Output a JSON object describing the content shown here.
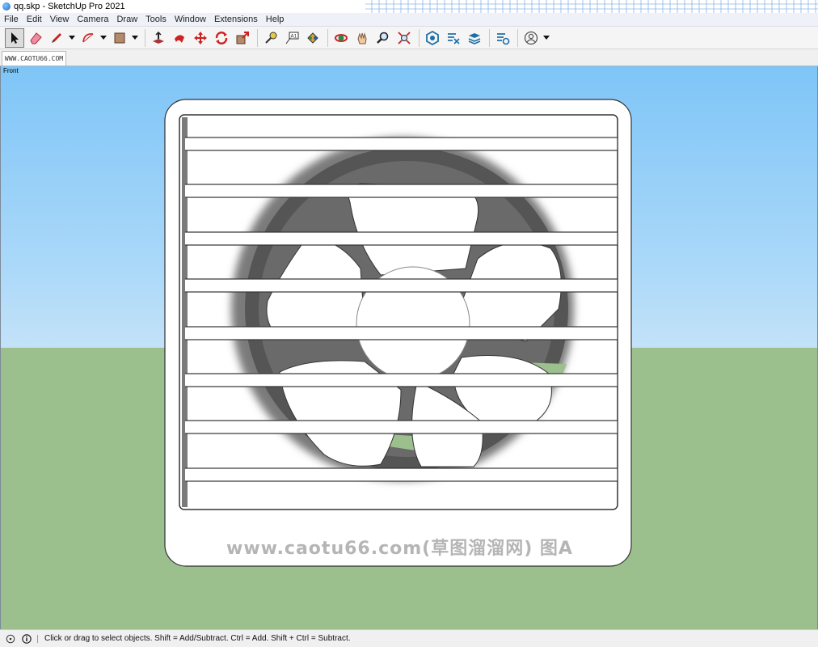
{
  "window": {
    "title": "qq.skp - SketchUp Pro 2021"
  },
  "menu": [
    "File",
    "Edit",
    "View",
    "Camera",
    "Draw",
    "Tools",
    "Window",
    "Extensions",
    "Help"
  ],
  "toolbar": {
    "tools": [
      "select-arrow-icon",
      "eraser-icon",
      "pencil-line-icon",
      "arc-icon",
      "shape-rectangle-icon",
      "push-pull-icon",
      "follow-me-icon",
      "move-icon",
      "rotate-icon",
      "scale-icon",
      "tape-measure-icon",
      "text-icon",
      "paint-bucket-icon",
      "orbit-icon",
      "pan-icon",
      "zoom-icon",
      "zoom-extents-icon",
      "extension-warehouse-icon",
      "send-to-layout-icon",
      "extension-manager-icon",
      "3d-warehouse-icon",
      "account-icon"
    ]
  },
  "tab": {
    "label": "WWW.CAOTU66.COM"
  },
  "viewport": {
    "view_name": "Front",
    "watermark": "www.caotu66.com(草图溜溜网) 图A",
    "colors": {
      "sky": "#7ec5f7",
      "ground": "#9cbf8e",
      "fan_ring": "#555555"
    }
  },
  "status": {
    "message": "Click or drag to select objects. Shift = Add/Subtract. Ctrl = Add. Shift + Ctrl = Subtract."
  }
}
